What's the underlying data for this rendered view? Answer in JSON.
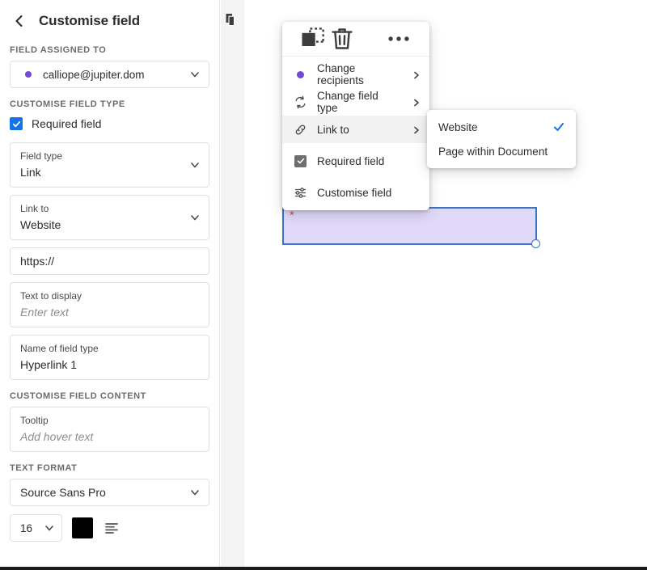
{
  "sidebar": {
    "back_icon": "chevron-left-icon",
    "title": "Customise field",
    "assigned_section_label": "FIELD ASSIGNED TO",
    "assigned": {
      "dot_color": "#7649d4",
      "value": "calliope@jupiter.dom",
      "chevron_icon": "chevron-down-icon"
    },
    "customise_type_label": "CUSTOMISE FIELD TYPE",
    "required_checkbox": {
      "label": "Required field",
      "checked": true,
      "color": "#1473e6"
    },
    "field_type": {
      "label": "Field type",
      "value": "Link"
    },
    "link_to": {
      "label": "Link to",
      "value": "Website"
    },
    "url_field": {
      "value": "https://"
    },
    "text_to_display": {
      "label": "Text to display",
      "placeholder": "Enter text"
    },
    "name_of_field_type": {
      "label": "Name of field type",
      "value": "Hyperlink 1"
    },
    "customise_content_label": "CUSTOMISE FIELD CONTENT",
    "tooltip": {
      "label": "Tooltip",
      "placeholder": "Add hover text"
    },
    "text_format_label": "TEXT FORMAT",
    "font_family": {
      "value": "Source Sans Pro"
    },
    "font_size": {
      "value": "16"
    },
    "text_color": {
      "value": "#000000"
    },
    "align_icon": "text-align-left-icon"
  },
  "canvas": {
    "pages_icon": "duplicate-pages-icon"
  },
  "context_menu": {
    "toolbar": [
      {
        "icon": "duplicate-icon",
        "name": "duplicate-button"
      },
      {
        "icon": "trash-icon",
        "name": "delete-button"
      },
      {
        "icon": "more-options-icon",
        "name": "more-options-button"
      }
    ],
    "items": [
      {
        "icon": "recipient-dot-icon",
        "label": "Change recipients",
        "has_arrow": true,
        "dot_color": "#7649d4"
      },
      {
        "icon": "sync-arrows-icon",
        "label": "Change field type",
        "has_arrow": true
      },
      {
        "icon": "link-chain-icon",
        "label": "Link to",
        "has_arrow": true,
        "hovered": true
      },
      {
        "icon": "checkbox-checked-icon",
        "label": "Required field",
        "has_arrow": false,
        "checked": true,
        "checkbox_color": "#6e6e6e"
      },
      {
        "icon": "sliders-icon",
        "label": "Customise field",
        "has_arrow": false
      }
    ]
  },
  "submenu": {
    "items": [
      {
        "label": "Website",
        "selected": true,
        "check_color": "#1473e6"
      },
      {
        "label": "Page within Document",
        "selected": false
      }
    ]
  },
  "document_field": {
    "required_marker": "*",
    "fill_color": "#e0d9f8",
    "border_color": "#3a73c8",
    "resize_handle": "resize-handle"
  }
}
